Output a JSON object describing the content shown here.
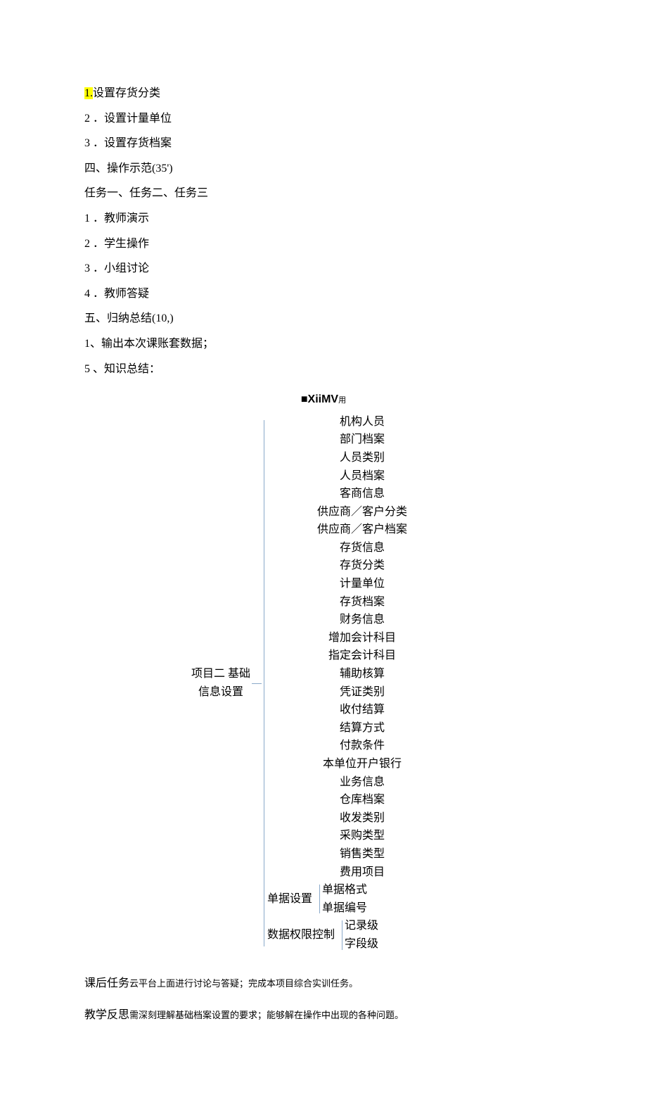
{
  "list_a": {
    "item1_hl_num": "1.",
    "item1_rest": "设置存货分类",
    "item2": "2 ．设置计量单位",
    "item3": "3 ．设置存货档案"
  },
  "section4": {
    "title": "四、操作示范(35')",
    "sub1": "任务一、任务二、任务三",
    "l1": "1 ．教师演示",
    "l2": "2 ．学生操作",
    "l3": "3 ．小组讨论",
    "l4": "4 ．教师答疑"
  },
  "section5": {
    "title": "五、归纳总结(10,)",
    "l1": "1、输出本次课账套数据；",
    "l2": "5 、知识总结："
  },
  "diagram": {
    "title_main": "■XiiMV",
    "title_suffix": "用",
    "root": "项目二  基础信息设置",
    "groups": [
      {
        "name": "机构人员",
        "leaves": [
          "部门档案",
          "人员类别",
          "人员档案"
        ]
      },
      {
        "name": "客商信息",
        "leaves": [
          "供应商／客户分类",
          "供应商／客户档案"
        ]
      },
      {
        "name": "存货信息",
        "leaves": [
          "存货分类",
          "计量单位",
          "存货档案"
        ]
      },
      {
        "name": "财务信息",
        "leaves": [
          "增加会计科目",
          "指定会计科目",
          "辅助核算",
          "凭证类别"
        ]
      },
      {
        "name": "收付结算",
        "leaves": [
          "结算方式",
          "付款条件",
          "本单位开户银行"
        ]
      },
      {
        "name": "业务信息",
        "leaves": [
          "仓库档案",
          "收发类别",
          "采购类型",
          "销售类型",
          "费用项目"
        ],
        "sub": [
          {
            "name": "单据设置",
            "leaves": [
              "单据格式",
              "单据编号"
            ]
          },
          {
            "name": "数据权限控制",
            "leaves": [
              "记录级",
              "字段级"
            ]
          }
        ]
      }
    ]
  },
  "post": {
    "task_label": "课后任务",
    "task_text": "云平台上面进行讨论与答疑；完成本项目综合实训任务。",
    "reflect_label": "教学反思",
    "reflect_text": "需深刻理解基础档案设置的要求；能够解在操作中出现的各种问题。"
  }
}
